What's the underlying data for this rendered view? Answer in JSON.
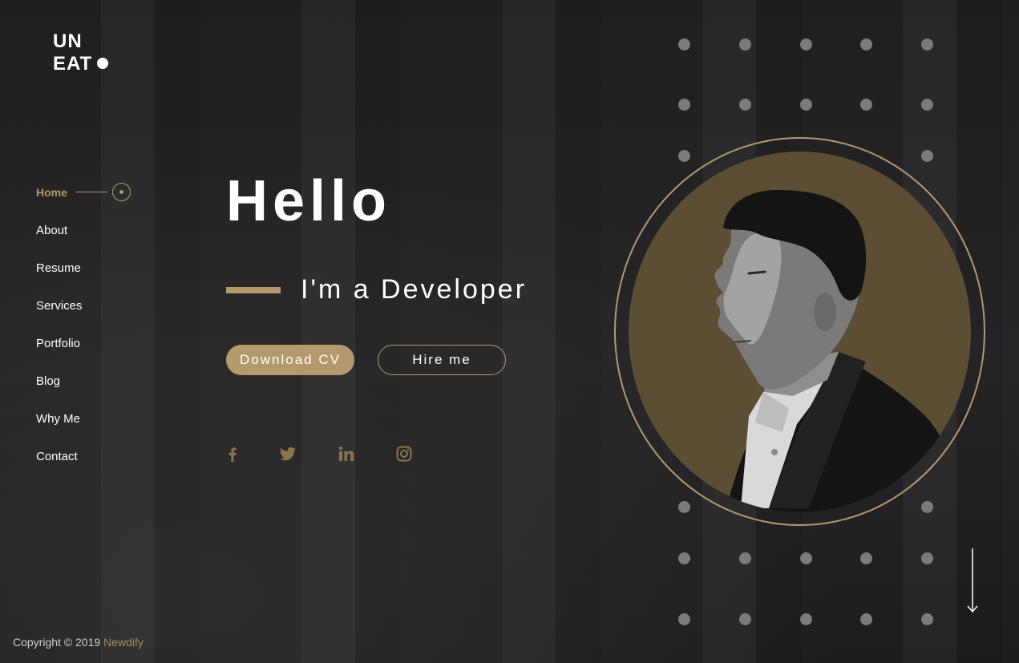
{
  "logo": {
    "line1": "UN",
    "line2": "EAT"
  },
  "nav": {
    "items": [
      {
        "label": "Home",
        "active": true
      },
      {
        "label": "About"
      },
      {
        "label": "Resume"
      },
      {
        "label": "Services"
      },
      {
        "label": "Portfolio"
      },
      {
        "label": "Blog"
      },
      {
        "label": "Why Me"
      },
      {
        "label": "Contact"
      }
    ]
  },
  "hero": {
    "greeting": "Hello",
    "role": "I'm a Developer",
    "download_label": "Download CV",
    "hire_label": "Hire me"
  },
  "social": [
    {
      "icon": "facebook-icon"
    },
    {
      "icon": "twitter-icon"
    },
    {
      "icon": "linkedin-icon"
    },
    {
      "icon": "instagram-icon"
    }
  ],
  "footer": {
    "copyright": "Copyright © 2019",
    "brand": "Newdify"
  },
  "colors": {
    "accent": "#b39a6d",
    "portrait_bg": "#5c4d35",
    "background": "#232325",
    "dots": "#7b7b7d"
  }
}
